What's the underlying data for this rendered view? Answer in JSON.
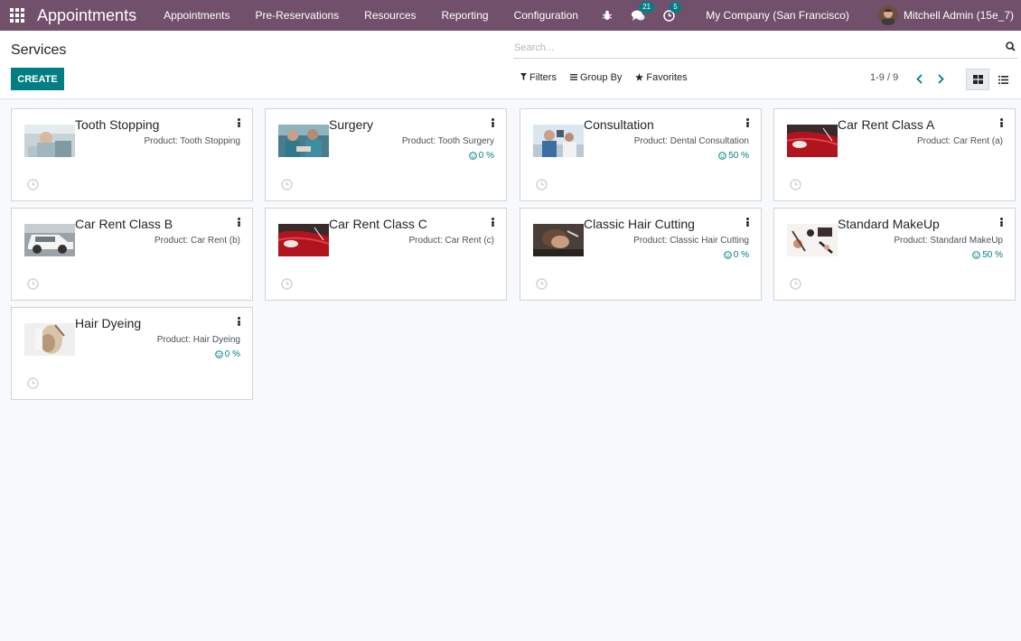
{
  "navbar": {
    "brand": "Appointments",
    "menu": [
      "Appointments",
      "Pre-Reservations",
      "Resources",
      "Reporting",
      "Configuration"
    ],
    "messages_count": "21",
    "activities_count": "5",
    "company": "My Company (San Francisco)",
    "user": "Mitchell Admin (15e_7)"
  },
  "control_panel": {
    "title": "Services",
    "create_label": "CREATE",
    "search_placeholder": "Search...",
    "filters_label": "Filters",
    "group_by_label": "Group By",
    "favorites_label": "Favorites",
    "pager": "1-9 / 9",
    "active_view": "kanban"
  },
  "colors": {
    "navbar": "#71506b",
    "primary": "#017e84",
    "background": "#f8f9fb"
  },
  "cards": [
    {
      "title": "Tooth Stopping",
      "product": "Product: Tooth Stopping",
      "rating": "",
      "image": "dentist-photo"
    },
    {
      "title": "Surgery",
      "product": "Product: Tooth Surgery",
      "rating": "0 %",
      "image": "surgery-photo"
    },
    {
      "title": "Consultation",
      "product": "Product: Dental Consultation",
      "rating": "50 %",
      "image": "consultation-photo"
    },
    {
      "title": "Car Rent Class A",
      "product": "Product: Car Rent (a)",
      "rating": "",
      "image": "red-car-photo"
    },
    {
      "title": "Car Rent Class B",
      "product": "Product: Car Rent (b)",
      "rating": "",
      "image": "white-suv-photo"
    },
    {
      "title": "Car Rent Class C",
      "product": "Product: Car Rent (c)",
      "rating": "",
      "image": "red-car-photo"
    },
    {
      "title": "Classic Hair Cutting",
      "product": "Product: Classic Hair Cutting",
      "rating": "0 %",
      "image": "haircut-photo"
    },
    {
      "title": "Standard MakeUp",
      "product": "Product: Standard MakeUp",
      "rating": "50 %",
      "image": "makeup-photo"
    },
    {
      "title": "Hair Dyeing",
      "product": "Product: Hair Dyeing",
      "rating": "0 %",
      "image": "hair-dyeing-photo"
    }
  ]
}
